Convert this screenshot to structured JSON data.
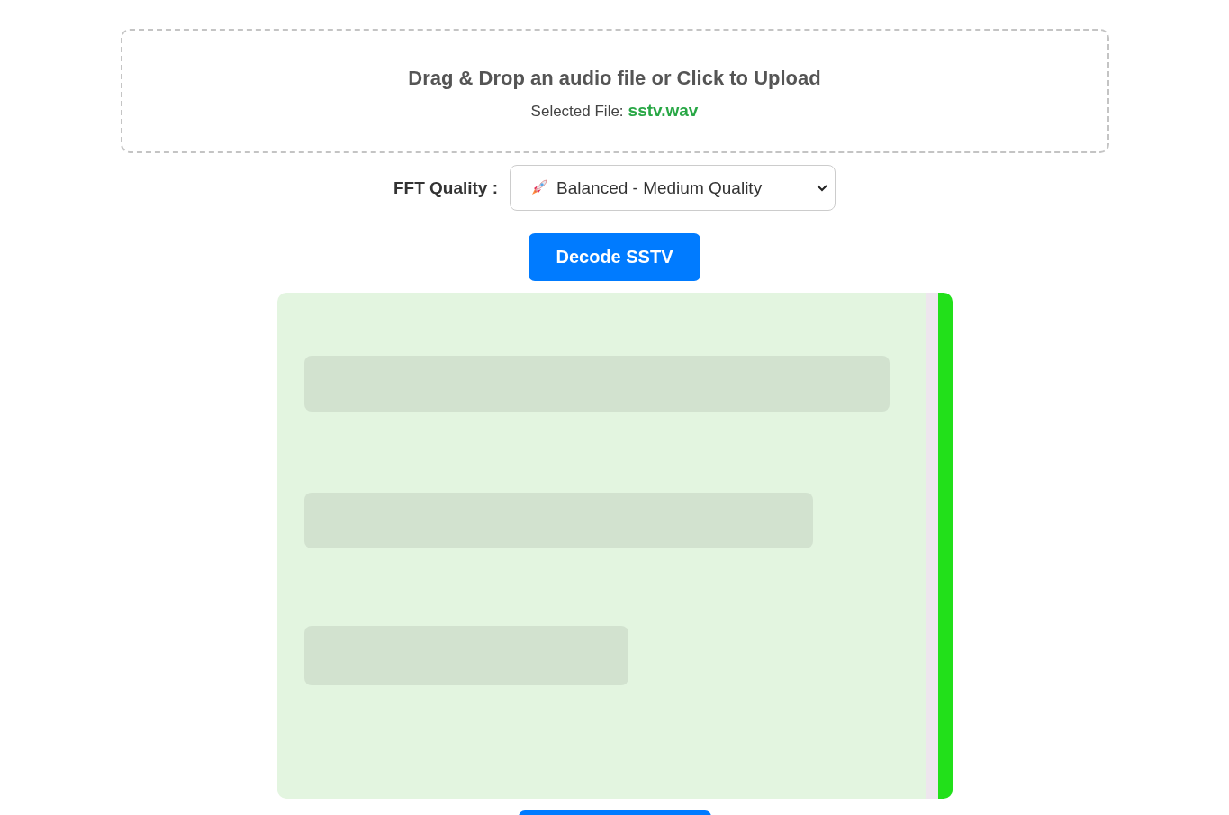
{
  "upload": {
    "prompt": "Drag & Drop an audio file or Click to Upload",
    "selected_label": "Selected File:",
    "selected_file": "sstv.wav"
  },
  "fft_quality": {
    "label": "FFT Quality :",
    "value": "Balanced - Medium Quality"
  },
  "decode_button": "Decode SSTV"
}
